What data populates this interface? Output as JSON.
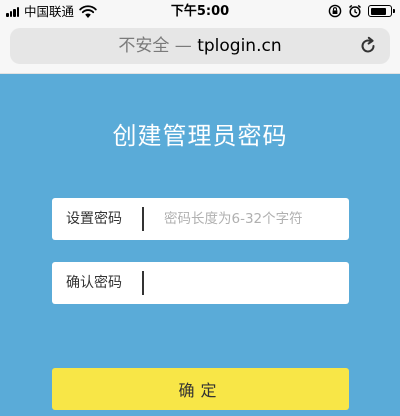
{
  "status_bar": {
    "carrier": "中国联通",
    "time": "下午5:00",
    "signal_bars": 4,
    "battery_level": 0.85
  },
  "browser": {
    "security_label": "不安全 — ",
    "host": "tplogin.cn",
    "icons": {
      "reload": "reload-icon",
      "wifi": "wifi-icon",
      "lock": "orientation-lock-icon",
      "alarm": "alarm-icon"
    }
  },
  "form": {
    "title": "创建管理员密码",
    "password_label": "设置密码",
    "password_placeholder": "密码长度为6-32个字符",
    "password_value": "",
    "confirm_label": "确认密码",
    "confirm_value": "",
    "submit_label": "确定"
  },
  "colors": {
    "background": "#5aabd8",
    "button": "#f8e647",
    "title_text": "#ffffff"
  }
}
